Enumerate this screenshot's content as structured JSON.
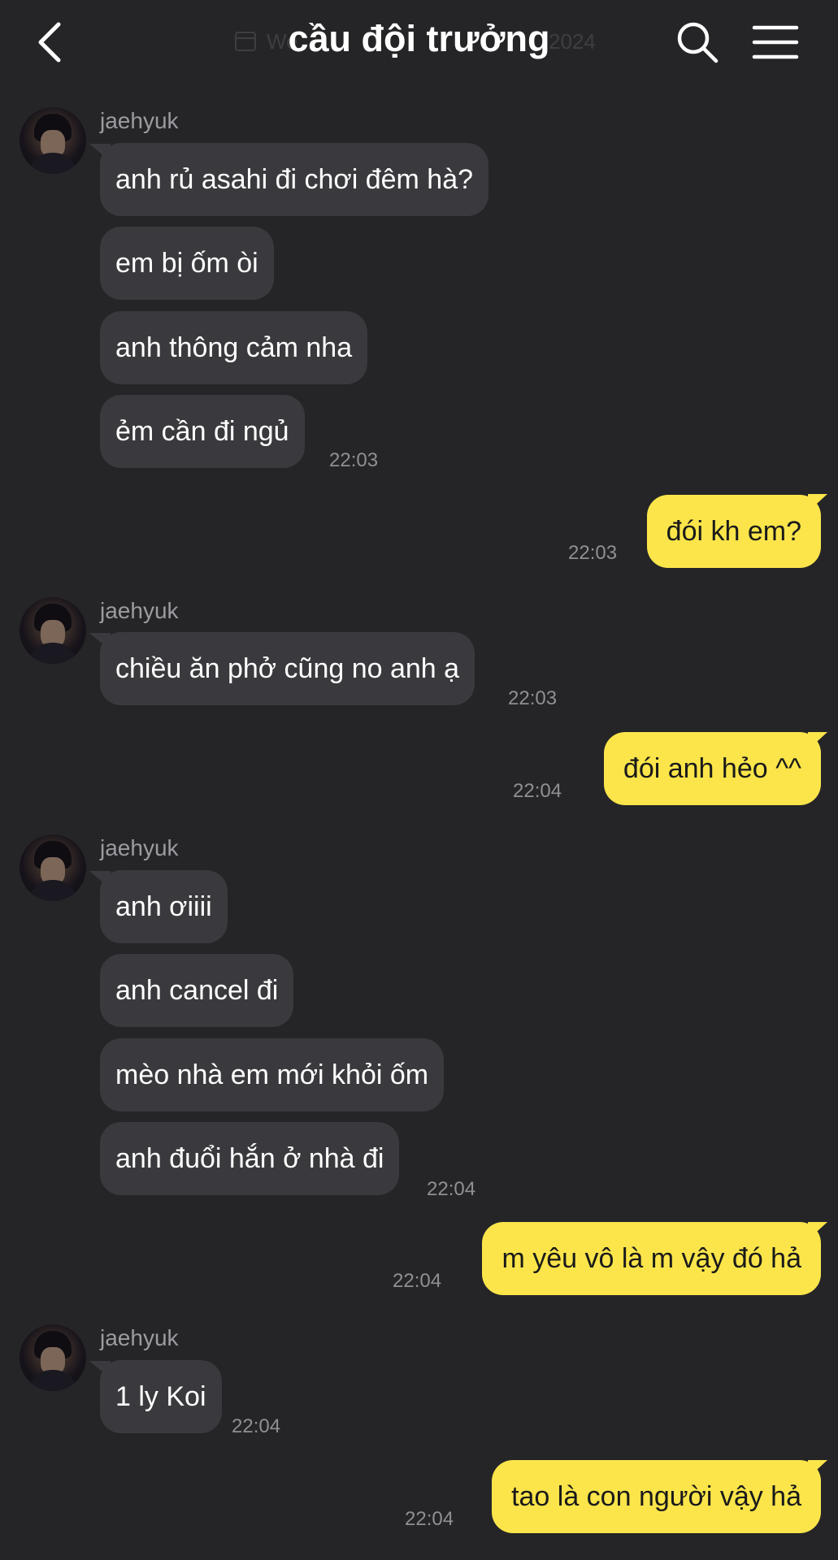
{
  "header": {
    "title": "cầu đội trưởng",
    "date_left": "We",
    "date_right": "2024",
    "back_icon": "chevron-left-icon",
    "search_icon": "search-icon",
    "menu_icon": "hamburger-menu-icon"
  },
  "colors": {
    "background": "#252528",
    "incoming_bubble": "#3a3a3e",
    "outgoing_bubble": "#fbe54a",
    "timestamp": "#8f8f94",
    "sender_name": "#9b9ba0"
  },
  "messages": {
    "g1": {
      "sender": "jaehyuk",
      "m1": "anh rủ asahi đi chơi đêm hà?",
      "m2": "em bị ốm òi",
      "m3": "anh thông cảm nha",
      "m4": "ẻm cần đi ngủ",
      "time": "22:03"
    },
    "o1": {
      "text": "đói kh em?",
      "time": "22:03"
    },
    "g2": {
      "sender": "jaehyuk",
      "m1": "chiều ăn phở cũng no anh ạ",
      "time": "22:03"
    },
    "o2": {
      "text": "đói anh hẻo ^^",
      "time": "22:04"
    },
    "g3": {
      "sender": "jaehyuk",
      "m1": "anh ơiiii",
      "m2": "anh cancel đi",
      "m3": "mèo nhà em mới khỏi ốm",
      "m4": "anh đuổi hắn ở nhà đi",
      "time": "22:04"
    },
    "o3": {
      "text": "m yêu vô là m vậy đó hả",
      "time": "22:04"
    },
    "g4": {
      "sender": "jaehyuk",
      "m1": "1 ly Koi",
      "time": "22:04"
    },
    "o4": {
      "text": "tao là con người vậy hả",
      "time": "22:04"
    }
  }
}
